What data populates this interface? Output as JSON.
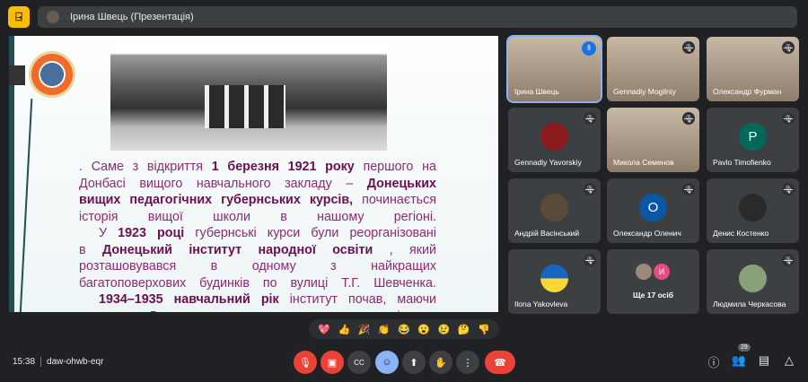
{
  "header": {
    "app_icon": "door-icon",
    "title": "Ірина Швець (Презентація)"
  },
  "slide": {
    "lines": [
      {
        "indent": false,
        "segs": [
          {
            "t": ". Саме з відкриття "
          },
          {
            "t": "1 березня 1921 року",
            "b": true
          },
          {
            "t": " першого на"
          }
        ]
      },
      {
        "indent": false,
        "segs": [
          {
            "t": "Донбасі вищого навчального закладу – "
          },
          {
            "t": "Донецьких",
            "b": true
          }
        ]
      },
      {
        "indent": false,
        "segs": [
          {
            "t": "вищих педагогічних губернських курсів,",
            "b": true
          },
          {
            "t": " починається"
          }
        ]
      },
      {
        "indent": false,
        "segs": [
          {
            "t": "історія вищої школи в нашому регіоні."
          }
        ]
      },
      {
        "indent": true,
        "segs": [
          {
            "t": "У "
          },
          {
            "t": "1923 році",
            "b": true
          },
          {
            "t": " губернські курси були реорганізовані"
          }
        ]
      },
      {
        "indent": false,
        "segs": [
          {
            "t": "в "
          },
          {
            "t": "Донецький інститут народної освіти",
            "b": true
          },
          {
            "t": ", який"
          }
        ]
      },
      {
        "indent": false,
        "segs": [
          {
            "t": "розташовувався в одному з найкращих"
          }
        ]
      },
      {
        "indent": false,
        "segs": [
          {
            "t": "багатоповерхових будинків по вулиці Т.Г. Шевченка."
          }
        ]
      },
      {
        "indent": true,
        "segs": [
          {
            "t": "1934–1935 навчальний рік",
            "b": true
          },
          {
            "t": " інститут почав, маючи"
          }
        ]
      },
      {
        "indent": false,
        "segs": [
          {
            "t": "статус Луганського державного педагогічного."
          }
        ]
      }
    ]
  },
  "participants": [
    {
      "name": "Ірина Швець",
      "type": "video",
      "speaking": true
    },
    {
      "name": "Gennadiy Mogilniy",
      "type": "video",
      "muted": true
    },
    {
      "name": "Олександр Фурман",
      "type": "video",
      "muted": true
    },
    {
      "name": "Gennadiy Yavorskiy",
      "type": "avatar",
      "color": "#8b1a1a",
      "muted": true
    },
    {
      "name": "Микола Семенов",
      "type": "video",
      "muted": true
    },
    {
      "name": "Pavlo Timofienko",
      "type": "avatar",
      "letter": "P",
      "color": "#00695c",
      "muted": true
    },
    {
      "name": "Андрій Васінський",
      "type": "avatar",
      "color": "#5a4a3a",
      "muted": true
    },
    {
      "name": "Олександр Оленич",
      "type": "avatar",
      "letter": "O",
      "color": "#0b57a4",
      "muted": true
    },
    {
      "name": "Денис Костенко",
      "type": "avatar",
      "color": "#2a2a2a",
      "muted": true
    },
    {
      "name": "Ilona Yakovleva",
      "type": "flag",
      "muted": true
    },
    {
      "name": "Ще 17 осіб",
      "type": "more",
      "letter": "И"
    },
    {
      "name": "Людмила Черкасова",
      "type": "avatar",
      "color": "#8aa07a",
      "muted": true
    }
  ],
  "reactions": [
    "💖",
    "👍",
    "🎉",
    "👏",
    "😂",
    "😮",
    "😢",
    "🤔",
    "👎"
  ],
  "footer": {
    "time": "15:38",
    "meeting_code": "daw-ohwb-eqr",
    "participant_count": "29"
  }
}
